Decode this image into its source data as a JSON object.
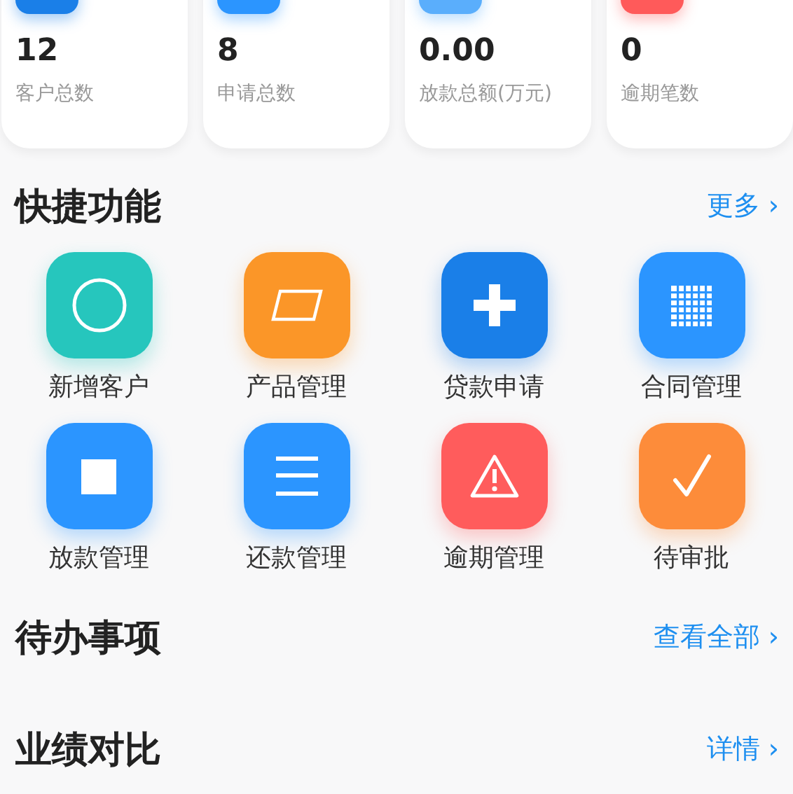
{
  "stats": [
    {
      "value": "12",
      "label": "客户总数",
      "color": "#1a7fe8"
    },
    {
      "value": "8",
      "label": "申请总数",
      "color": "#2b95ff"
    },
    {
      "value": "0.00",
      "label": "放款总额(万元)",
      "color": "#5aaefc"
    },
    {
      "value": "0",
      "label": "逾期笔数",
      "color": "#ff5a5a"
    }
  ],
  "quick": {
    "title": "快捷功能",
    "more": "更多 ›",
    "actions": [
      {
        "label": "新增客户",
        "kind": "circle",
        "color": "#26c6bd"
      },
      {
        "label": "产品管理",
        "kind": "parallelogram",
        "color": "#fb9628"
      },
      {
        "label": "贷款申请",
        "kind": "plus",
        "color": "#1a7fe8"
      },
      {
        "label": "合同管理",
        "kind": "grid",
        "color": "#2b95ff"
      },
      {
        "label": "放款管理",
        "kind": "square",
        "color": "#2b95ff"
      },
      {
        "label": "还款管理",
        "kind": "lines",
        "color": "#2b95ff"
      },
      {
        "label": "逾期管理",
        "kind": "warning",
        "color": "#ff5c5c"
      },
      {
        "label": "待审批",
        "kind": "check",
        "color": "#fd8c3a"
      }
    ]
  },
  "todo": {
    "title": "待办事项",
    "more": "查看全部 ›"
  },
  "performance": {
    "title": "业绩对比",
    "more": "详情 ›"
  }
}
